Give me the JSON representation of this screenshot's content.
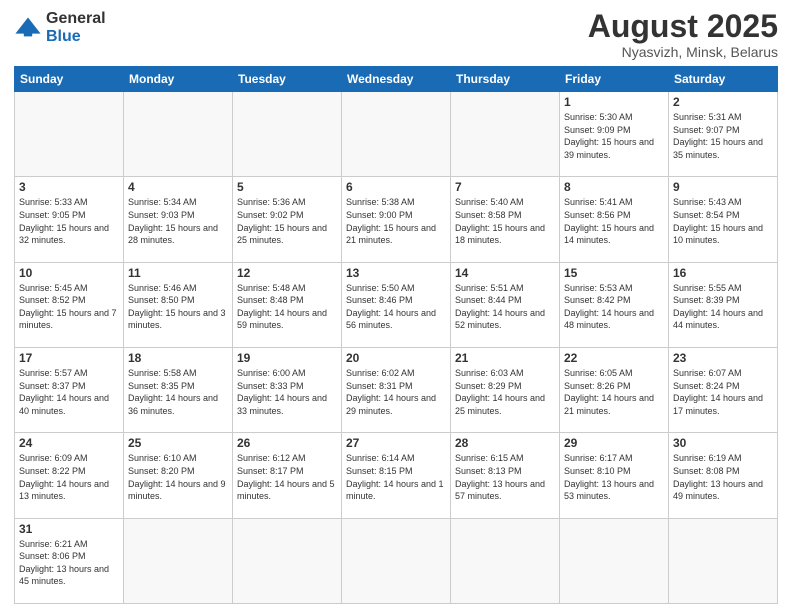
{
  "logo": {
    "line1": "General",
    "line2": "Blue"
  },
  "header": {
    "title": "August 2025",
    "subtitle": "Nyasvizh, Minsk, Belarus"
  },
  "weekdays": [
    "Sunday",
    "Monday",
    "Tuesday",
    "Wednesday",
    "Thursday",
    "Friday",
    "Saturday"
  ],
  "weeks": [
    [
      {
        "day": "",
        "info": ""
      },
      {
        "day": "",
        "info": ""
      },
      {
        "day": "",
        "info": ""
      },
      {
        "day": "",
        "info": ""
      },
      {
        "day": "",
        "info": ""
      },
      {
        "day": "1",
        "info": "Sunrise: 5:30 AM\nSunset: 9:09 PM\nDaylight: 15 hours\nand 39 minutes."
      },
      {
        "day": "2",
        "info": "Sunrise: 5:31 AM\nSunset: 9:07 PM\nDaylight: 15 hours\nand 35 minutes."
      }
    ],
    [
      {
        "day": "3",
        "info": "Sunrise: 5:33 AM\nSunset: 9:05 PM\nDaylight: 15 hours\nand 32 minutes."
      },
      {
        "day": "4",
        "info": "Sunrise: 5:34 AM\nSunset: 9:03 PM\nDaylight: 15 hours\nand 28 minutes."
      },
      {
        "day": "5",
        "info": "Sunrise: 5:36 AM\nSunset: 9:02 PM\nDaylight: 15 hours\nand 25 minutes."
      },
      {
        "day": "6",
        "info": "Sunrise: 5:38 AM\nSunset: 9:00 PM\nDaylight: 15 hours\nand 21 minutes."
      },
      {
        "day": "7",
        "info": "Sunrise: 5:40 AM\nSunset: 8:58 PM\nDaylight: 15 hours\nand 18 minutes."
      },
      {
        "day": "8",
        "info": "Sunrise: 5:41 AM\nSunset: 8:56 PM\nDaylight: 15 hours\nand 14 minutes."
      },
      {
        "day": "9",
        "info": "Sunrise: 5:43 AM\nSunset: 8:54 PM\nDaylight: 15 hours\nand 10 minutes."
      }
    ],
    [
      {
        "day": "10",
        "info": "Sunrise: 5:45 AM\nSunset: 8:52 PM\nDaylight: 15 hours\nand 7 minutes."
      },
      {
        "day": "11",
        "info": "Sunrise: 5:46 AM\nSunset: 8:50 PM\nDaylight: 15 hours\nand 3 minutes."
      },
      {
        "day": "12",
        "info": "Sunrise: 5:48 AM\nSunset: 8:48 PM\nDaylight: 14 hours\nand 59 minutes."
      },
      {
        "day": "13",
        "info": "Sunrise: 5:50 AM\nSunset: 8:46 PM\nDaylight: 14 hours\nand 56 minutes."
      },
      {
        "day": "14",
        "info": "Sunrise: 5:51 AM\nSunset: 8:44 PM\nDaylight: 14 hours\nand 52 minutes."
      },
      {
        "day": "15",
        "info": "Sunrise: 5:53 AM\nSunset: 8:42 PM\nDaylight: 14 hours\nand 48 minutes."
      },
      {
        "day": "16",
        "info": "Sunrise: 5:55 AM\nSunset: 8:39 PM\nDaylight: 14 hours\nand 44 minutes."
      }
    ],
    [
      {
        "day": "17",
        "info": "Sunrise: 5:57 AM\nSunset: 8:37 PM\nDaylight: 14 hours\nand 40 minutes."
      },
      {
        "day": "18",
        "info": "Sunrise: 5:58 AM\nSunset: 8:35 PM\nDaylight: 14 hours\nand 36 minutes."
      },
      {
        "day": "19",
        "info": "Sunrise: 6:00 AM\nSunset: 8:33 PM\nDaylight: 14 hours\nand 33 minutes."
      },
      {
        "day": "20",
        "info": "Sunrise: 6:02 AM\nSunset: 8:31 PM\nDaylight: 14 hours\nand 29 minutes."
      },
      {
        "day": "21",
        "info": "Sunrise: 6:03 AM\nSunset: 8:29 PM\nDaylight: 14 hours\nand 25 minutes."
      },
      {
        "day": "22",
        "info": "Sunrise: 6:05 AM\nSunset: 8:26 PM\nDaylight: 14 hours\nand 21 minutes."
      },
      {
        "day": "23",
        "info": "Sunrise: 6:07 AM\nSunset: 8:24 PM\nDaylight: 14 hours\nand 17 minutes."
      }
    ],
    [
      {
        "day": "24",
        "info": "Sunrise: 6:09 AM\nSunset: 8:22 PM\nDaylight: 14 hours\nand 13 minutes."
      },
      {
        "day": "25",
        "info": "Sunrise: 6:10 AM\nSunset: 8:20 PM\nDaylight: 14 hours\nand 9 minutes."
      },
      {
        "day": "26",
        "info": "Sunrise: 6:12 AM\nSunset: 8:17 PM\nDaylight: 14 hours\nand 5 minutes."
      },
      {
        "day": "27",
        "info": "Sunrise: 6:14 AM\nSunset: 8:15 PM\nDaylight: 14 hours\nand 1 minute."
      },
      {
        "day": "28",
        "info": "Sunrise: 6:15 AM\nSunset: 8:13 PM\nDaylight: 13 hours\nand 57 minutes."
      },
      {
        "day": "29",
        "info": "Sunrise: 6:17 AM\nSunset: 8:10 PM\nDaylight: 13 hours\nand 53 minutes."
      },
      {
        "day": "30",
        "info": "Sunrise: 6:19 AM\nSunset: 8:08 PM\nDaylight: 13 hours\nand 49 minutes."
      }
    ],
    [
      {
        "day": "31",
        "info": "Sunrise: 6:21 AM\nSunset: 8:06 PM\nDaylight: 13 hours\nand 45 minutes."
      },
      {
        "day": "",
        "info": ""
      },
      {
        "day": "",
        "info": ""
      },
      {
        "day": "",
        "info": ""
      },
      {
        "day": "",
        "info": ""
      },
      {
        "day": "",
        "info": ""
      },
      {
        "day": "",
        "info": ""
      }
    ]
  ]
}
